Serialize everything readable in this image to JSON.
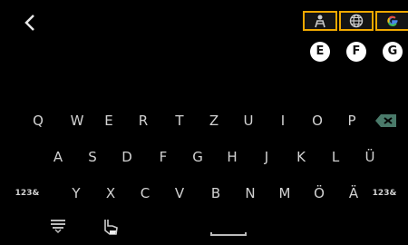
{
  "header": {
    "back_icon": "chevron-left-icon",
    "mode_buttons": [
      {
        "name": "handwriting-mode",
        "icon": "pen-person-icon"
      },
      {
        "name": "language-mode",
        "icon": "globe-icon"
      },
      {
        "name": "google-mode",
        "icon": "google-icon"
      }
    ],
    "markers": [
      "E",
      "F",
      "G"
    ]
  },
  "keyboard": {
    "row1": [
      "Q",
      "W",
      "E",
      "R",
      "T",
      "Z",
      "U",
      "I",
      "O",
      "P"
    ],
    "row2": [
      "A",
      "S",
      "D",
      "F",
      "G",
      "H",
      "J",
      "K",
      "L",
      "Ü"
    ],
    "row3_left": "123&",
    "row3": [
      "Y",
      "X",
      "C",
      "V",
      "B",
      "N",
      "M",
      "Ö",
      "Ä"
    ],
    "row3_right": "123&"
  },
  "bottom_bar": {
    "icons": [
      "keyboard-hide-icon",
      "touch-hand-icon",
      "space-bar-icon"
    ]
  },
  "colors": {
    "highlight": "#f0a800",
    "background": "#000000",
    "key_text": "#d2d2d2"
  }
}
